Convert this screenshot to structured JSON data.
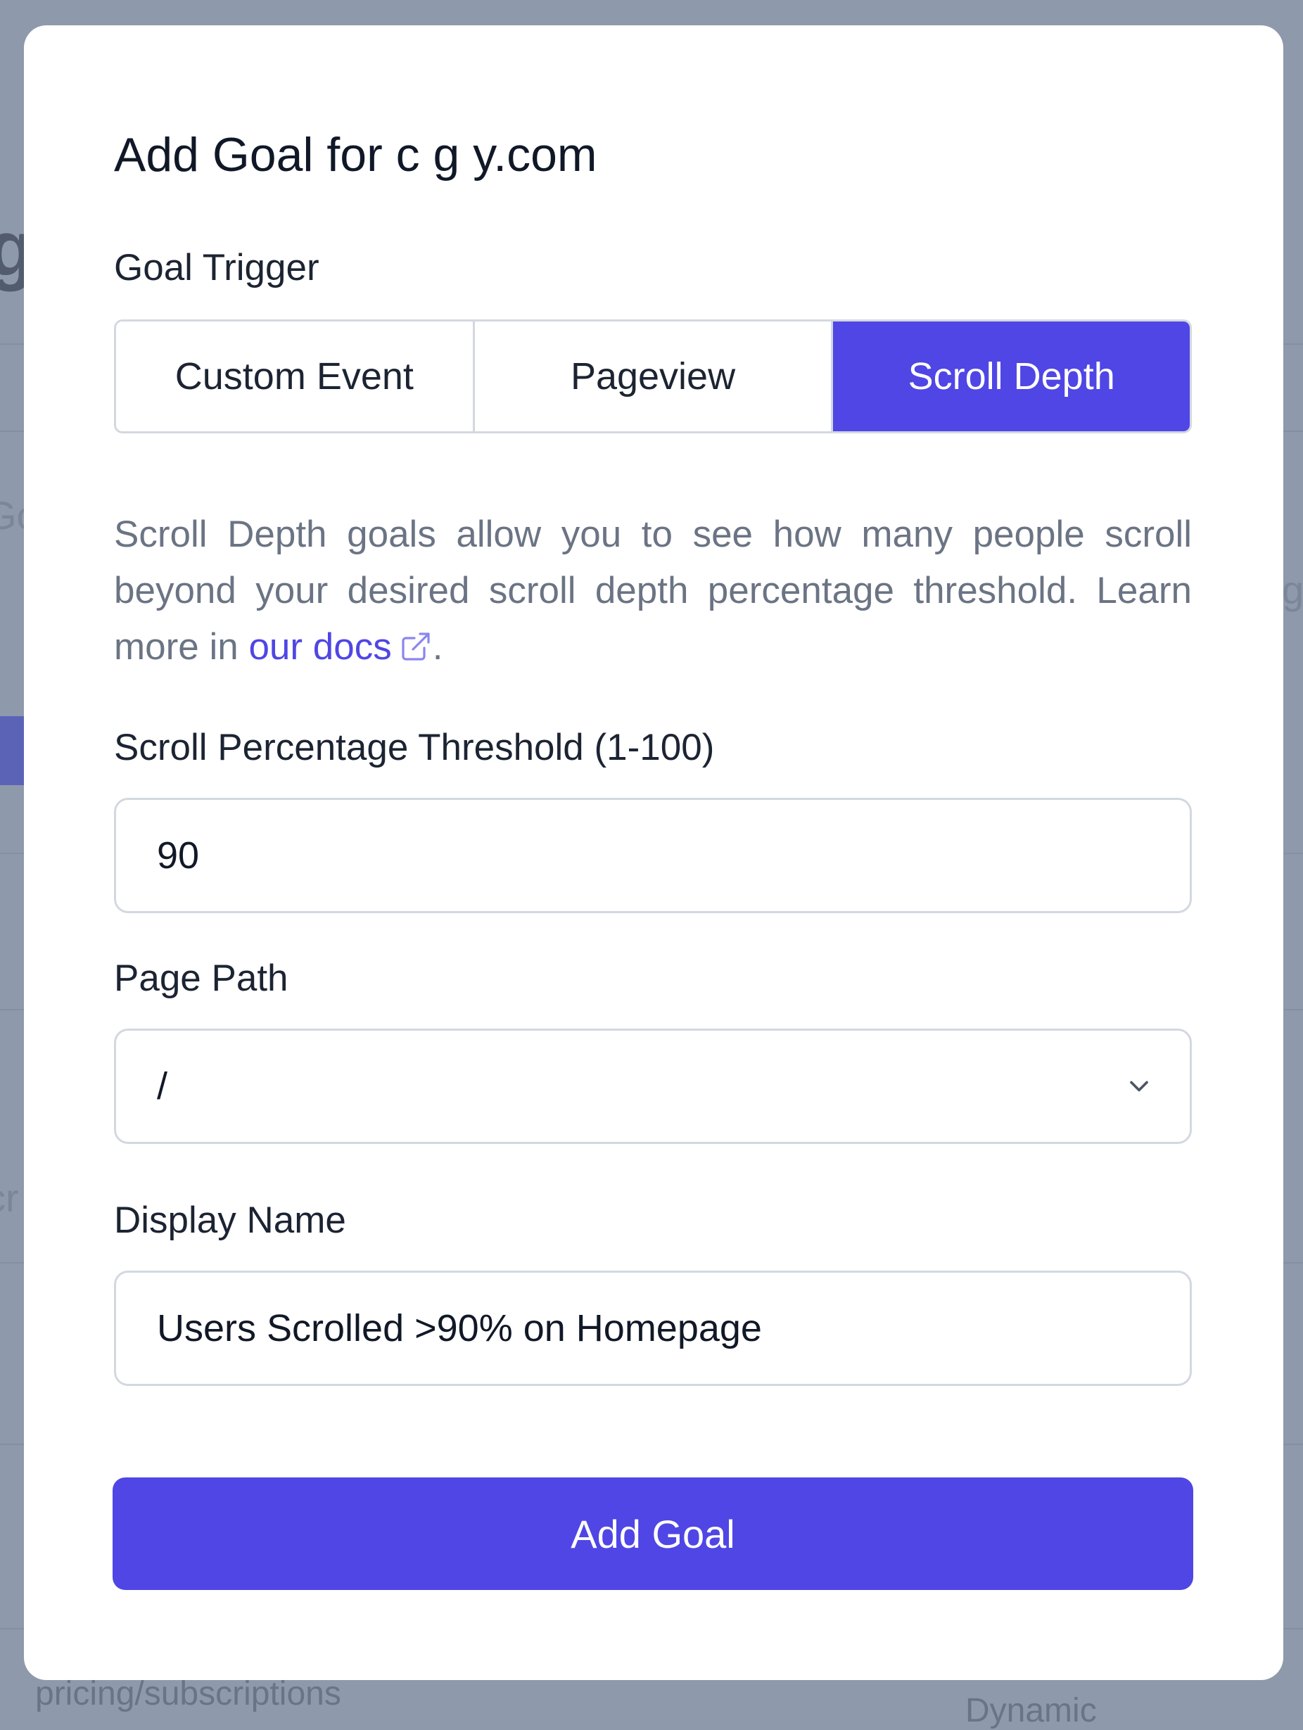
{
  "background": {
    "footer_path_text": "pricing/subscriptions",
    "footer_right_text": "Dynamic"
  },
  "modal": {
    "title": "Add Goal for c          g      y.com",
    "goal_trigger": {
      "label": "Goal Trigger",
      "options": [
        "Custom Event",
        "Pageview",
        "Scroll Depth"
      ],
      "selected": "Scroll Depth"
    },
    "description": {
      "text": "Scroll Depth goals allow you to see how many people scroll beyond your desired scroll depth percentage threshold. Learn more in ",
      "link_text": "our docs",
      "suffix": "."
    },
    "threshold": {
      "label": "Scroll Percentage Threshold (1-100)",
      "value": "90"
    },
    "page_path": {
      "label": "Page Path",
      "value": "/"
    },
    "display_name": {
      "label": "Display Name",
      "value": "Users Scrolled >90% on Homepage"
    },
    "submit_label": "Add Goal"
  },
  "colors": {
    "accent": "#4f46e5",
    "backdrop": "#8e99ab"
  },
  "icons": {
    "docs_link": "external-link-icon",
    "select": "chevron-down-icon"
  }
}
